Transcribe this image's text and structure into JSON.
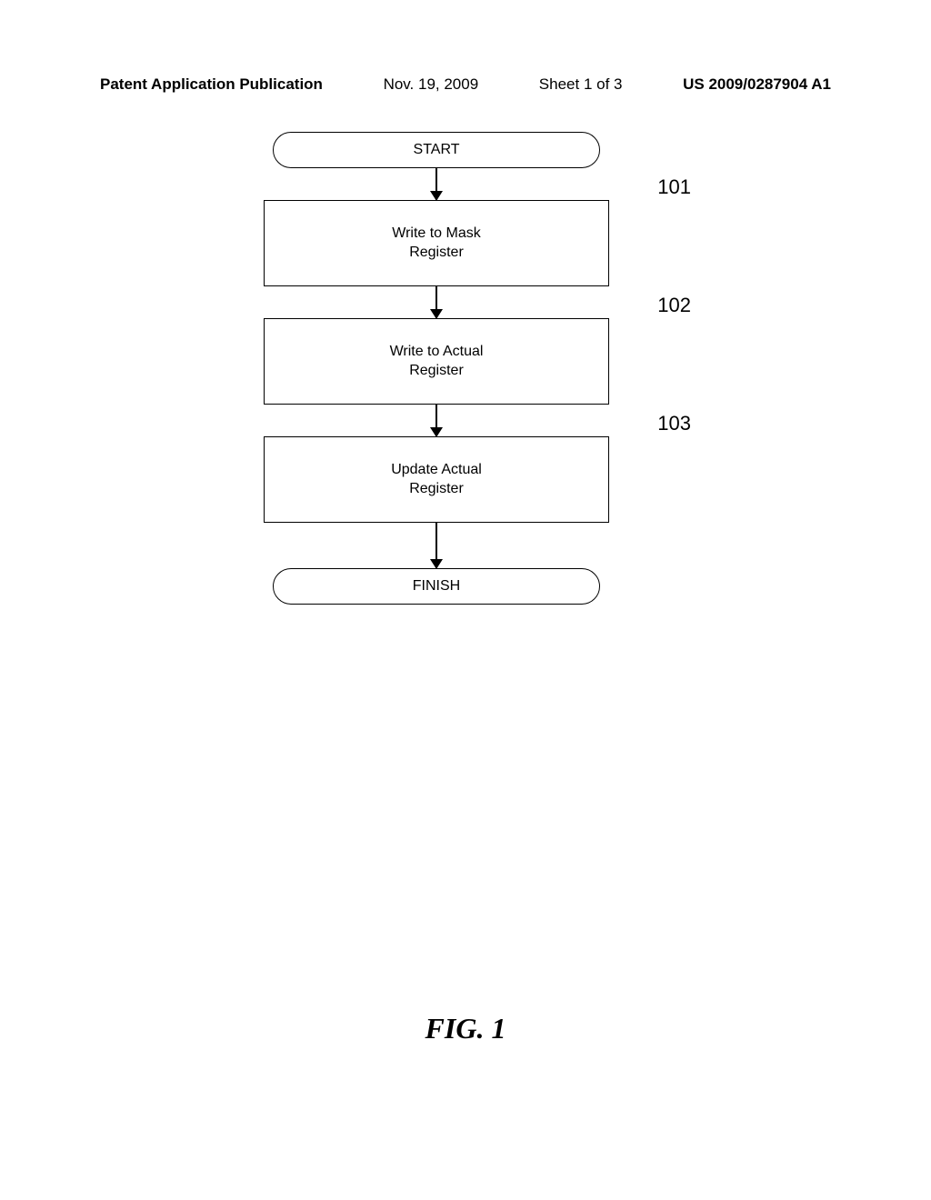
{
  "header": {
    "publication_text": "Patent Application Publication",
    "date": "Nov. 19, 2009",
    "sheet": "Sheet 1 of 3",
    "pub_number": "US 2009/0287904 A1"
  },
  "flowchart": {
    "start_label": "START",
    "finish_label": "FINISH",
    "steps": [
      {
        "line1": "Write to Mask",
        "line2": "Register",
        "ref": "101"
      },
      {
        "line1": "Write to Actual",
        "line2": "Register",
        "ref": "102"
      },
      {
        "line1": "Update Actual",
        "line2": "Register",
        "ref": "103"
      }
    ]
  },
  "figure_label": "FIG. 1"
}
